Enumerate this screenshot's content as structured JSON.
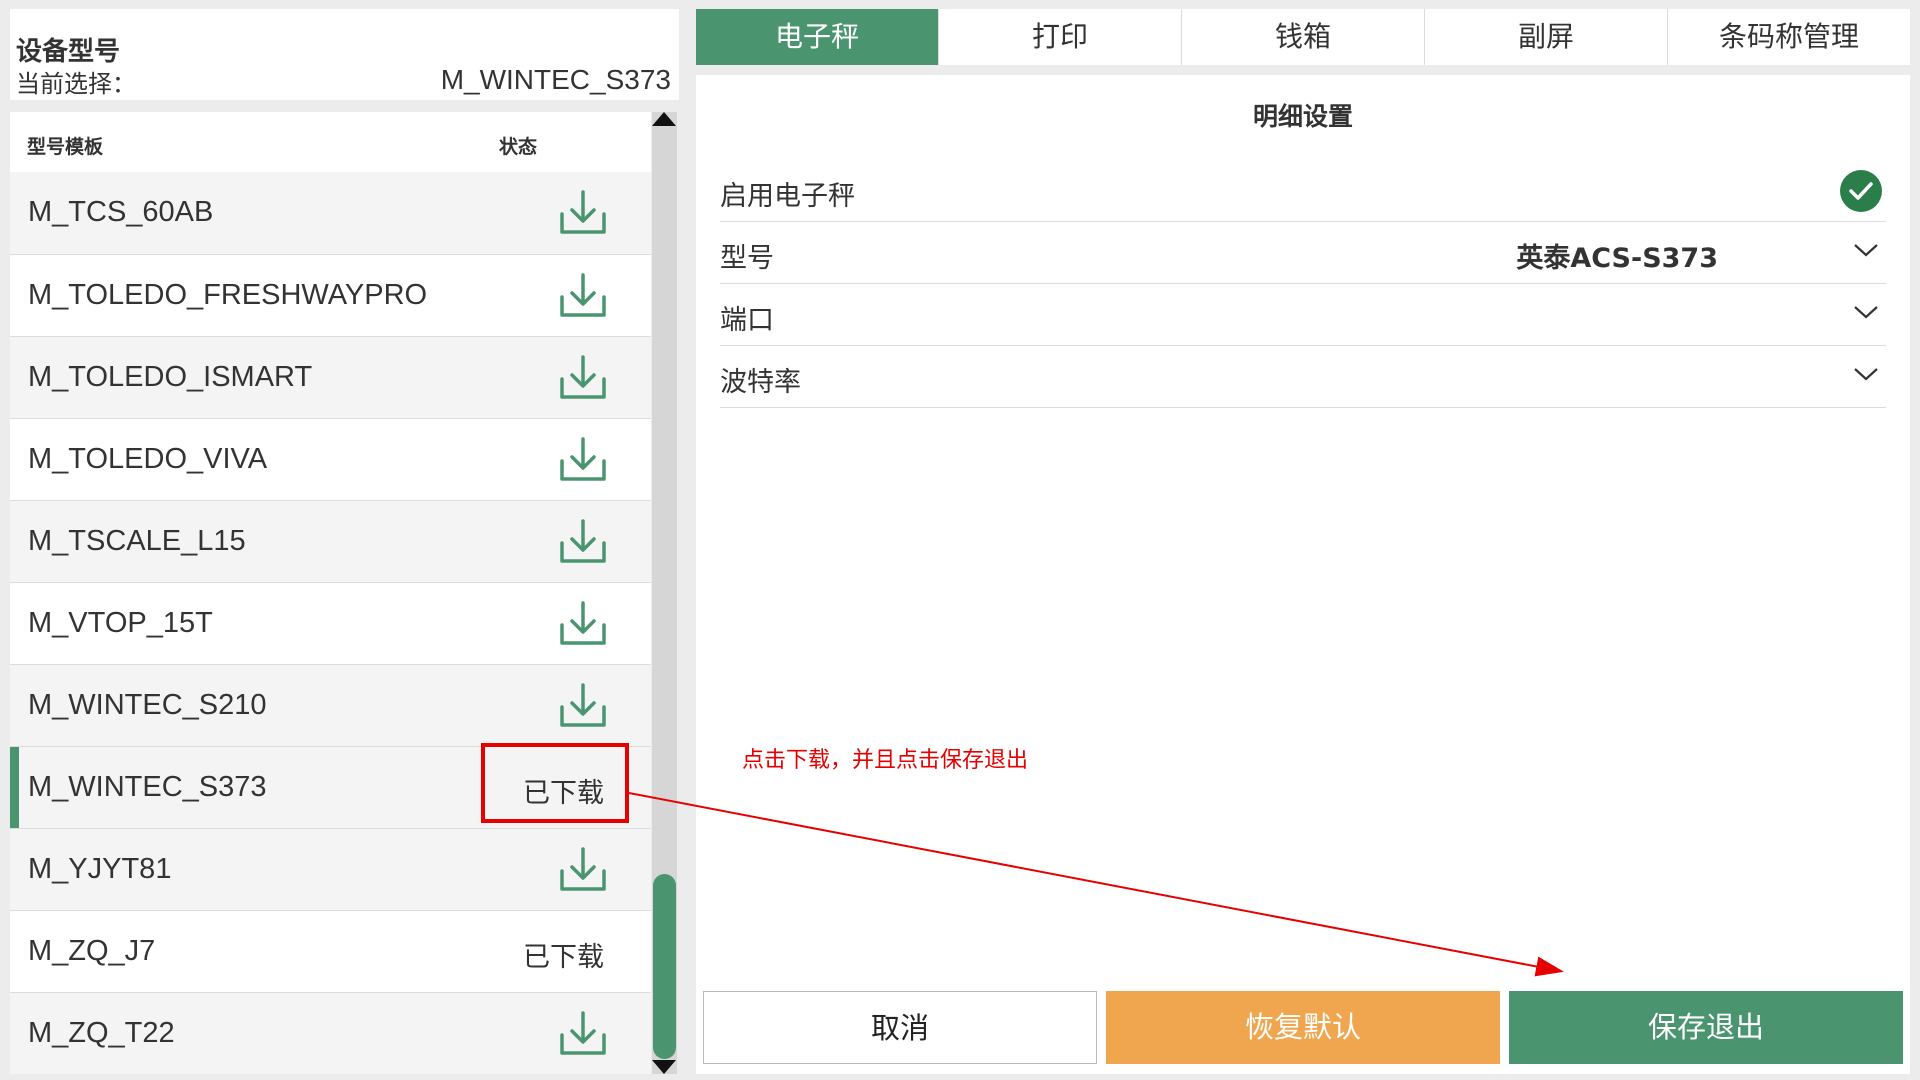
{
  "device": {
    "title": "设备型号",
    "current_label": "当前选择：",
    "current_value": "M_WINTEC_S373"
  },
  "list": {
    "col_model": "型号模板",
    "col_status": "状态",
    "rows": [
      {
        "name": "M_TCS_60AB",
        "status": "download"
      },
      {
        "name": "M_TOLEDO_FRESHWAYPRO",
        "status": "download"
      },
      {
        "name": "M_TOLEDO_ISMART",
        "status": "download"
      },
      {
        "name": "M_TOLEDO_VIVA",
        "status": "download"
      },
      {
        "name": "M_TSCALE_L15",
        "status": "download"
      },
      {
        "name": "M_VTOP_15T",
        "status": "download"
      },
      {
        "name": "M_WINTEC_S210",
        "status": "download"
      },
      {
        "name": "M_WINTEC_S373",
        "status": "已下载",
        "selected": true
      },
      {
        "name": "M_YJYT81",
        "status": "download"
      },
      {
        "name": "M_ZQ_J7",
        "status": "已下载"
      },
      {
        "name": "M_ZQ_T22",
        "status": "download"
      }
    ]
  },
  "tabs": [
    "电子秤",
    "打印",
    "钱箱",
    "副屏",
    "条码称管理"
  ],
  "detail": {
    "title": "明细设置",
    "enable_label": "启用电子秤",
    "model_label": "型号",
    "model_value": "英泰ACS-S373",
    "port_label": "端口",
    "baud_label": "波特率"
  },
  "annotation": "点击下载，并且点击保存退出",
  "buttons": {
    "cancel": "取消",
    "restore": "恢复默认",
    "save": "保存退出"
  },
  "colors": {
    "accent": "#4a9570",
    "restore": "#f0a54f",
    "annotation": "#e60000"
  }
}
